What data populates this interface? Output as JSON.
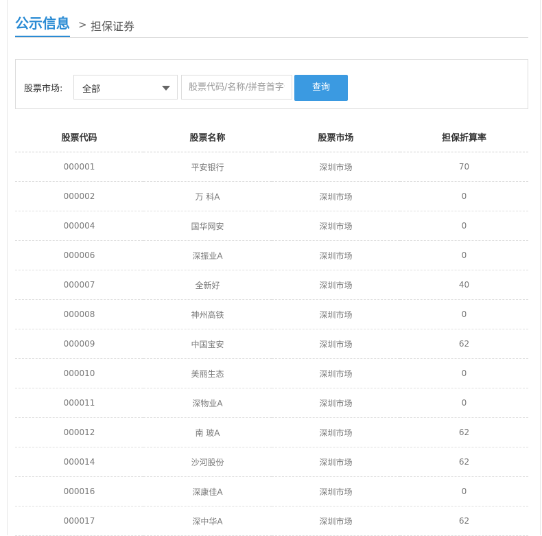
{
  "header": {
    "title": "公示信息",
    "separator": ">",
    "subtitle": "担保证券"
  },
  "search": {
    "market_label": "股票市场:",
    "market_selected": "全部",
    "query_placeholder": "股票代码/名称/拼音首字母",
    "query_value": "",
    "submit_label": "查询"
  },
  "table": {
    "columns": [
      "股票代码",
      "股票名称",
      "股票市场",
      "担保折算率"
    ],
    "rows": [
      [
        "000001",
        "平安银行",
        "深圳市场",
        "70"
      ],
      [
        "000002",
        "万 科A",
        "深圳市场",
        "0"
      ],
      [
        "000004",
        "国华网安",
        "深圳市场",
        "0"
      ],
      [
        "000006",
        "深振业A",
        "深圳市场",
        "0"
      ],
      [
        "000007",
        "全新好",
        "深圳市场",
        "40"
      ],
      [
        "000008",
        "神州高铁",
        "深圳市场",
        "0"
      ],
      [
        "000009",
        "中国宝安",
        "深圳市场",
        "62"
      ],
      [
        "000010",
        "美丽生态",
        "深圳市场",
        "0"
      ],
      [
        "000011",
        "深物业A",
        "深圳市场",
        "0"
      ],
      [
        "000012",
        "南 玻A",
        "深圳市场",
        "62"
      ],
      [
        "000014",
        "沙河股份",
        "深圳市场",
        "62"
      ],
      [
        "000016",
        "深康佳A",
        "深圳市场",
        "0"
      ],
      [
        "000017",
        "深中华A",
        "深圳市场",
        "62"
      ]
    ]
  }
}
